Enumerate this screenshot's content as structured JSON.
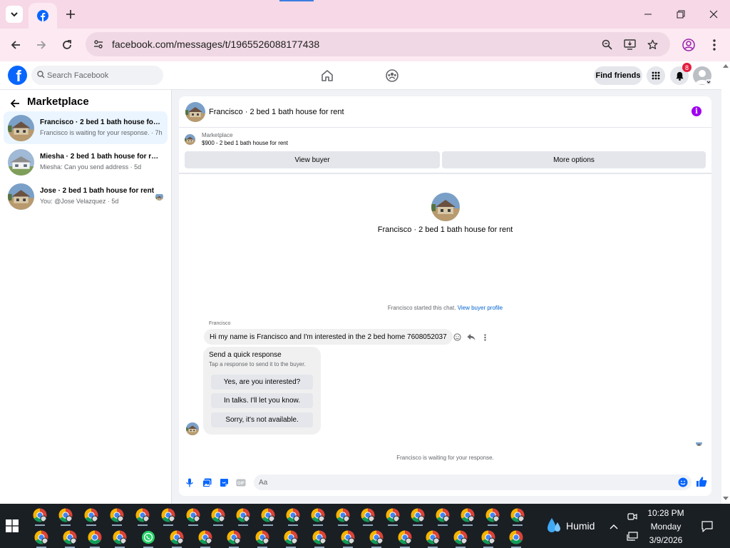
{
  "browser": {
    "url": "facebook.com/messages/t/1965526088177438"
  },
  "facebook": {
    "search_placeholder": "Search Facebook",
    "find_friends": "Find friends",
    "notification_count": "8",
    "brand_color": "#0866ff"
  },
  "sidebar": {
    "title": "Marketplace",
    "conversations": [
      {
        "name": "Francisco · 2 bed 1 bath house for ...",
        "preview": "Francisco is waiting for your response. · 7h",
        "active": true
      },
      {
        "name": "Miesha · 2 bed 1 bath house for rent",
        "preview": "Miesha: Can you send address · 5d",
        "active": false
      },
      {
        "name": "Jose · 2 bed 1 bath house for rent",
        "preview": "You: @Jose Velazquez · 5d",
        "active": false
      }
    ]
  },
  "chat": {
    "header_title": "Francisco · 2 bed 1 bath house for rent",
    "listing_label": "Marketplace",
    "listing_price": "$900 - 2 bed 1 bath house for rent",
    "view_buyer": "View buyer",
    "more_options": "More options",
    "hero_title": "Francisco · 2 bed 1 bath house for rent",
    "started_text": "Francisco started this chat.",
    "view_buyer_profile": "View buyer profile",
    "sender_name": "Francisco",
    "message": "Hi my name is Francisco and I'm interested in the 2 bed home 7608052037",
    "quick_response": {
      "title": "Send a quick response",
      "subtitle": "Tap a response to send it to the buyer.",
      "options": [
        "Yes, are you interested?",
        "In talks. I'll let you know.",
        "Sorry, it's not available."
      ]
    },
    "waiting_text": "Francisco is waiting for your response.",
    "composer_placeholder": "Aa"
  },
  "taskbar": {
    "weather_text": "Humid",
    "time": "10:28 PM",
    "day": "Monday",
    "date": "3/9/2026"
  }
}
